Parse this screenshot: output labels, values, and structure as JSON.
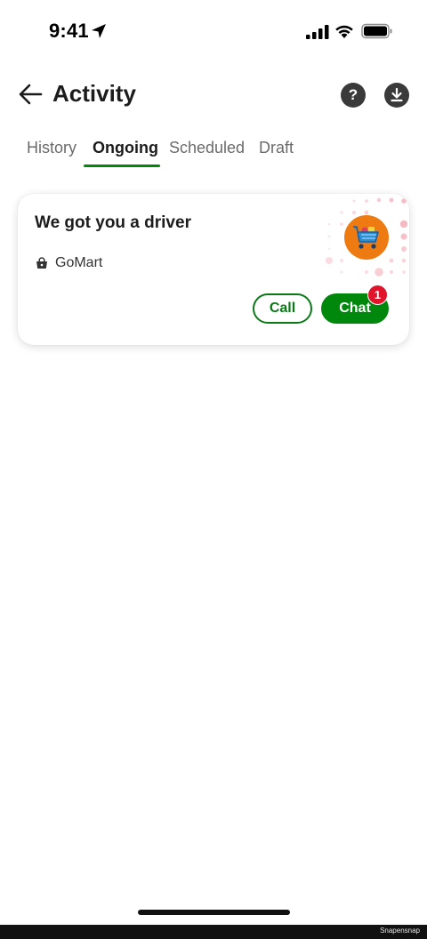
{
  "status_bar": {
    "time": "9:41"
  },
  "header": {
    "title": "Activity",
    "help_label": "?"
  },
  "tabs": [
    {
      "label": "History",
      "active": false
    },
    {
      "label": "Ongoing",
      "active": true
    },
    {
      "label": "Scheduled",
      "active": false
    },
    {
      "label": "Draft",
      "active": false
    }
  ],
  "order_card": {
    "title": "We got you a driver",
    "merchant": "GoMart",
    "call_label": "Call",
    "chat_label": "Chat",
    "chat_unread_count": "1"
  },
  "footer": {
    "watermark": "Snapensnap"
  },
  "colors": {
    "accent_green": "#00880d",
    "badge_red": "#e0142a",
    "merchant_orange": "#ee7a12"
  },
  "icons": {
    "back": "arrow-left-icon",
    "help": "question-circle-icon",
    "download": "download-icon",
    "merchant_type": "shopping-bag-icon",
    "merchant_logo": "shopping-cart-icon"
  }
}
